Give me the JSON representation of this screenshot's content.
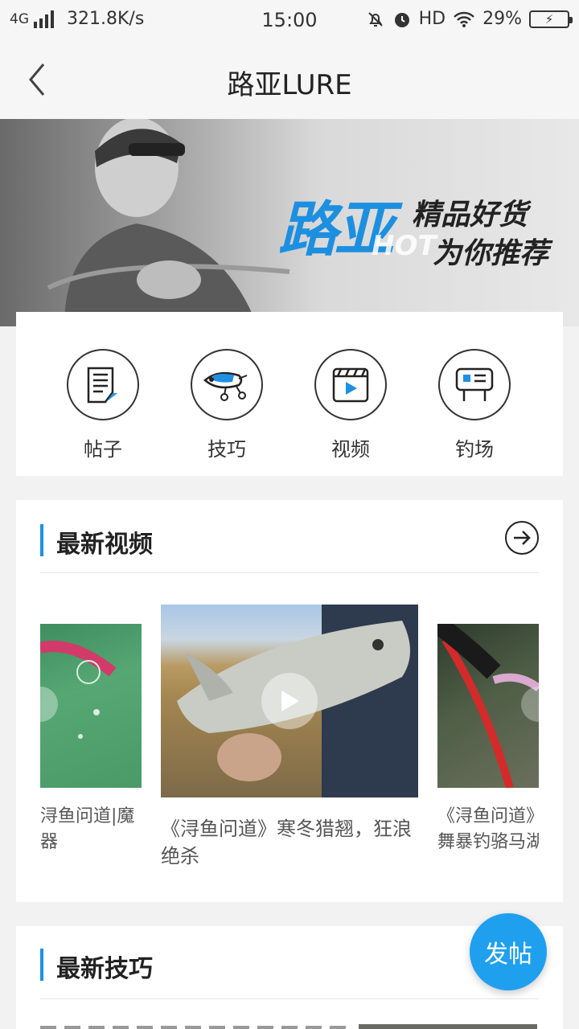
{
  "status_bar": {
    "network": "4G",
    "speed": "321.8K/s",
    "time": "15:00",
    "hd": "HD",
    "battery": "29%",
    "icons": [
      "signal-icon",
      "mute-bell-icon",
      "alarm-icon",
      "wifi-icon",
      "battery-icon"
    ]
  },
  "nav": {
    "title": "路亚LURE",
    "back_icon": "chevron-left-icon"
  },
  "banner": {
    "big_text": "路亚",
    "hot_text": "HOT",
    "line1": "精品好货",
    "line2": "为你推荐"
  },
  "categories": [
    {
      "label": "帖子",
      "icon": "document-icon"
    },
    {
      "label": "技巧",
      "icon": "lure-icon"
    },
    {
      "label": "视频",
      "icon": "video-play-icon"
    },
    {
      "label": "钓场",
      "icon": "sign-board-icon"
    }
  ],
  "latest_videos": {
    "title": "最新视频",
    "more_icon": "arrow-right-circle-icon",
    "items": [
      {
        "title_line1": "浔鱼问道|魔",
        "title_line2": "器"
      },
      {
        "title": "《浔鱼问道》寒冬猎翘，狂浪绝杀"
      },
      {
        "title_line1": "《浔鱼问道》",
        "title_line2": "舞暴钓骆马湖"
      }
    ]
  },
  "latest_skills": {
    "title": "最新技巧"
  },
  "fab": {
    "label": "发帖"
  },
  "colors": {
    "accent": "#1e90e3",
    "fab": "#1fa0ef",
    "background": "#f2f2f2"
  }
}
